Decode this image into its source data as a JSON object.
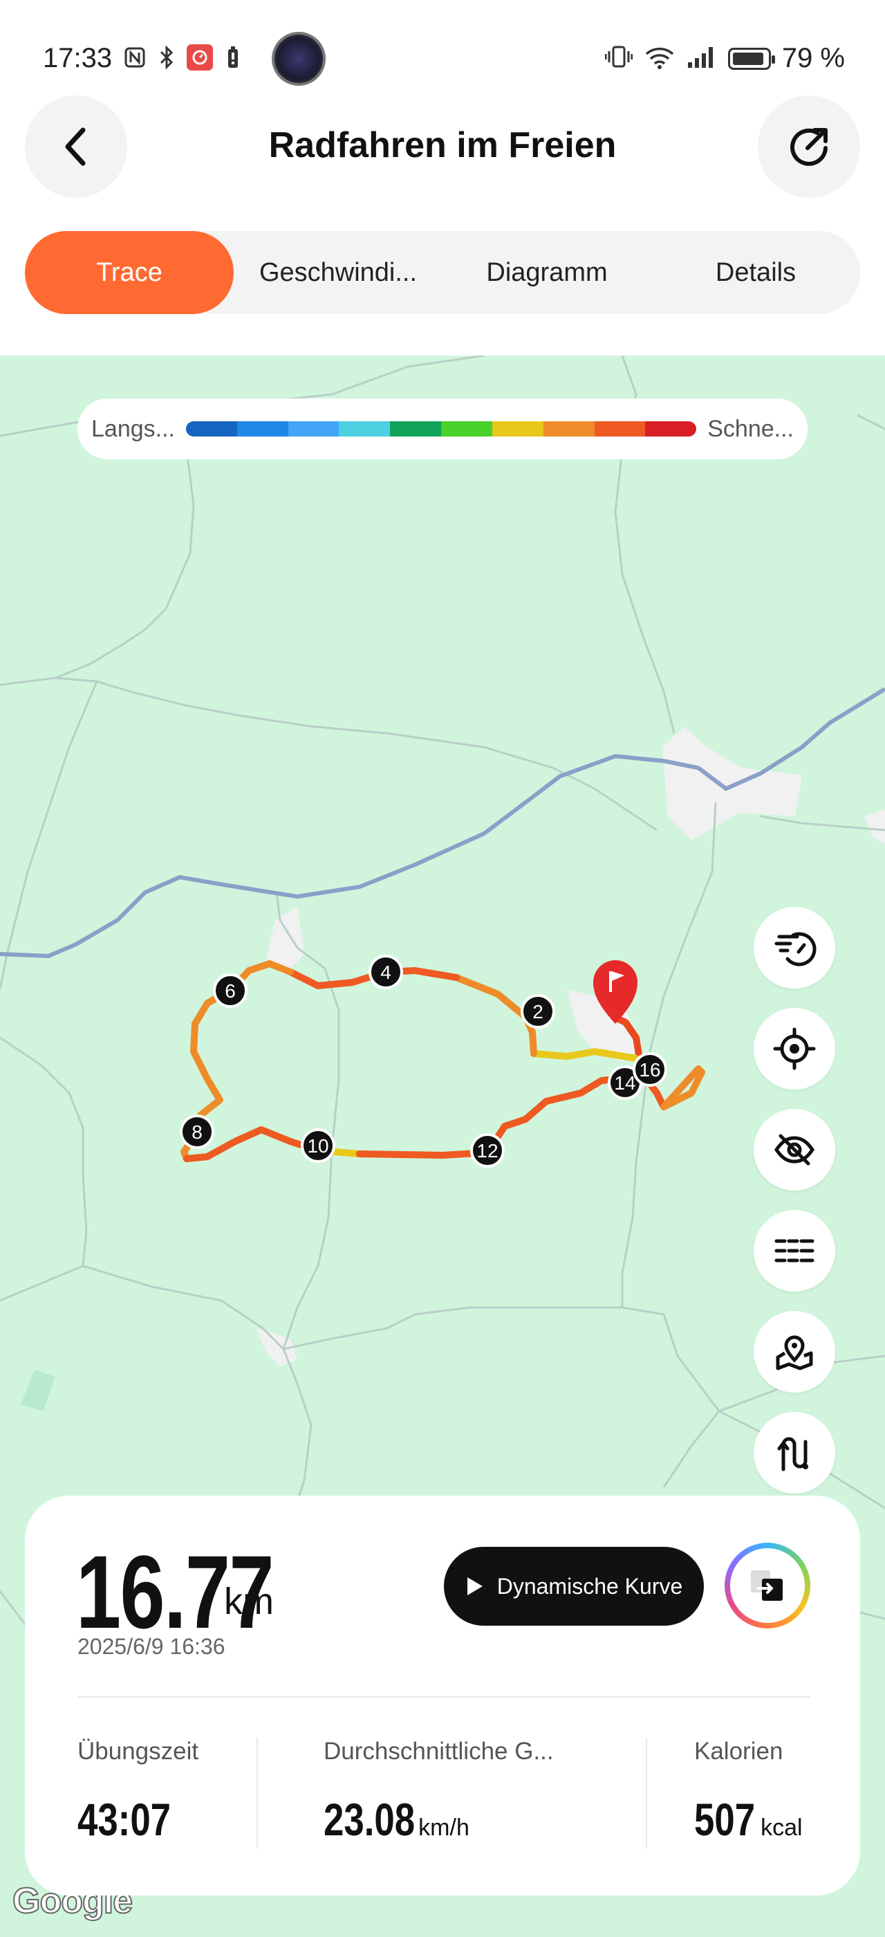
{
  "status_bar": {
    "time": "17:33",
    "battery_pct": "79 %"
  },
  "header": {
    "title": "Radfahren im Freien"
  },
  "tabs": [
    {
      "label": "Trace",
      "active": true
    },
    {
      "label": "Geschwindi...",
      "active": false
    },
    {
      "label": "Diagramm",
      "active": false
    },
    {
      "label": "Details",
      "active": false
    }
  ],
  "legend": {
    "slow_label": "Langs...",
    "fast_label": "Schne...",
    "colors": [
      "#1565c0",
      "#1e88e5",
      "#42a5f5",
      "#4dd0e1",
      "#10a35a",
      "#48d12a",
      "#e8c81a",
      "#ee8c2a",
      "#ee5a22",
      "#d81f26"
    ]
  },
  "route": {
    "markers": [
      "2",
      "4",
      "6",
      "8",
      "10",
      "12",
      "14",
      "16"
    ],
    "finish_icon": "flag-icon"
  },
  "map_buttons": [
    "speedometer-icon",
    "locate-icon",
    "eye-off-icon",
    "list-icon",
    "map-pin-icon",
    "route-icon"
  ],
  "map_attribution": "Google",
  "summary": {
    "distance_value": "16.77",
    "distance_unit": "km",
    "datetime": "2025/6/9 16:36",
    "dynamic_button_label": "Dynamische Kurve",
    "stats": [
      {
        "label": "Übungszeit",
        "value": "43:07",
        "unit": ""
      },
      {
        "label": "Durchschnittliche G...",
        "value": "23.08",
        "unit": "km/h"
      },
      {
        "label": "Kalorien",
        "value": "507",
        "unit": "kcal"
      }
    ]
  }
}
